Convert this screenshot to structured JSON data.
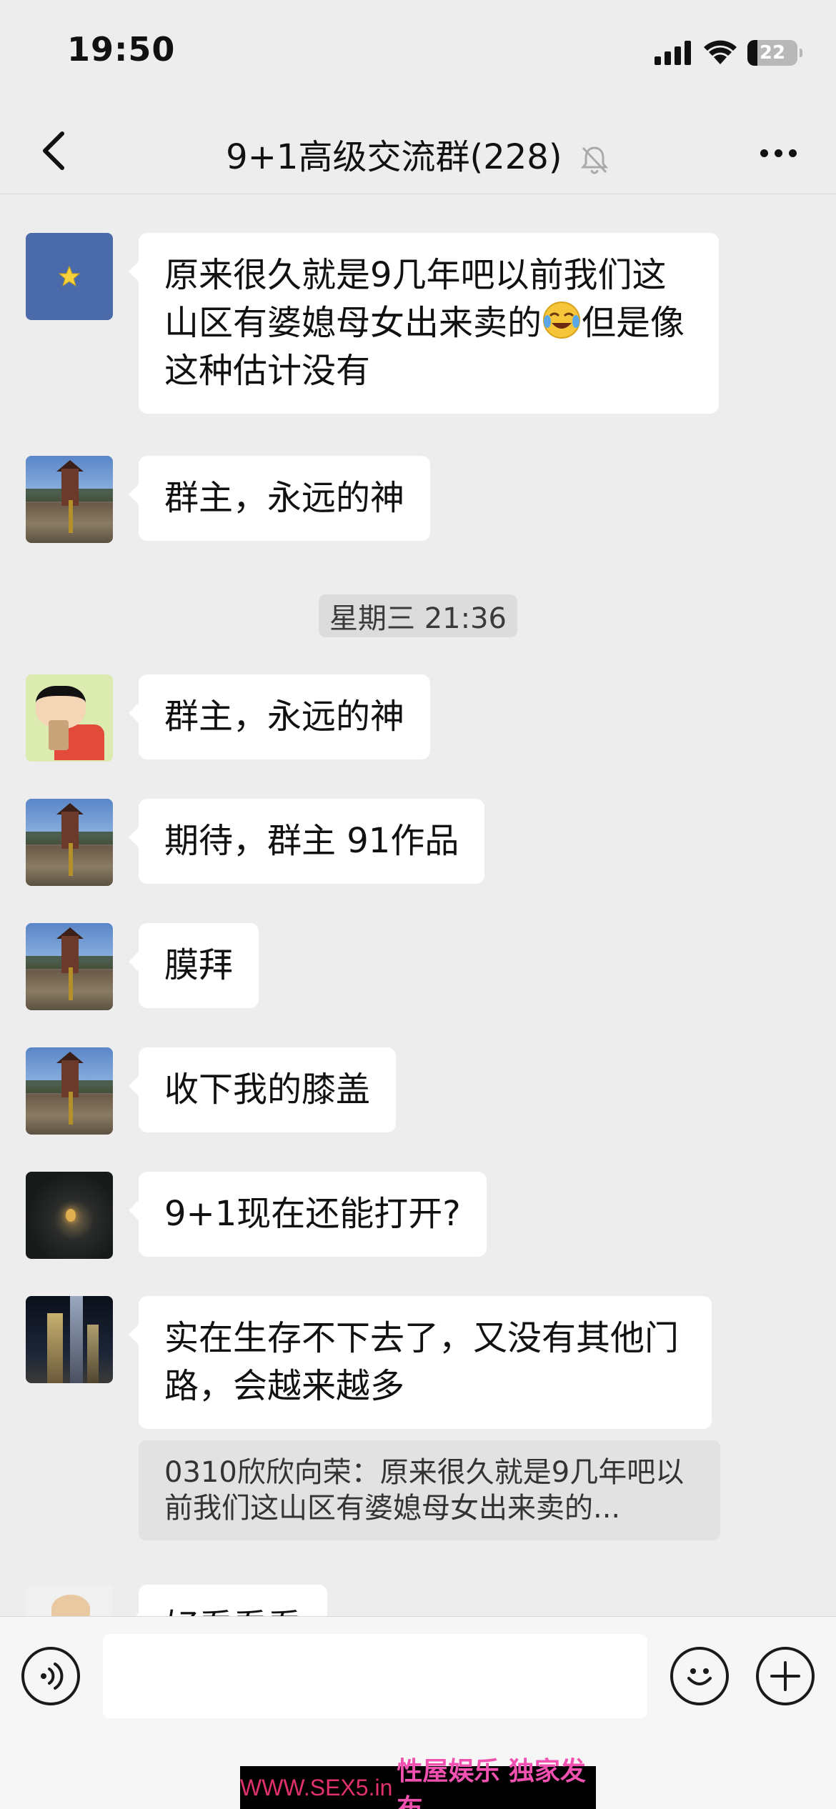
{
  "status_bar": {
    "time": "19:50",
    "battery": "22",
    "icons": [
      "signal-icon",
      "wifi-icon",
      "battery-icon"
    ]
  },
  "nav": {
    "title": "9+1高级交流群(228)",
    "icons": [
      "back-arrow-icon",
      "mute-bell-icon",
      "more-dots-icon"
    ]
  },
  "messages": [
    {
      "avatar": "star-flag",
      "text": "原来很久就是9几年吧以前我们这山区有婆媳母女出来卖的",
      "text_after_emoji": "但是像这种估计没有",
      "emoji": "tears-of-joy"
    },
    {
      "avatar": "town-square",
      "text": "群主，永远的神"
    },
    {
      "avatar": "cartoon-boy",
      "text": "群主，永远的神"
    },
    {
      "avatar": "town-square",
      "text": "期待，群主 91作品"
    },
    {
      "avatar": "town-square",
      "text": "膜拜"
    },
    {
      "avatar": "town-square",
      "text": "收下我的膝盖"
    },
    {
      "avatar": "dark-night",
      "text": "9+1现在还能打开?"
    },
    {
      "avatar": "city-towers",
      "text": "实在生存不下去了，又没有其他门路，会越来越多"
    },
    {
      "avatar": "hand",
      "text": "好看看看"
    }
  ],
  "timestamp": "星期三 21:36",
  "quote": "0310欣欣向荣：原来很久就是9几年吧以前我们这山区有婆媳母女出来卖的...",
  "input": {
    "placeholder": "",
    "icons": [
      "voice-icon",
      "emoji-icon",
      "plus-icon"
    ]
  },
  "watermark": {
    "url": "WWW.SEX5.in",
    "tag": "性屋娱乐 独家发布"
  },
  "colors": {
    "background": "#ededed",
    "bubble": "#ffffff",
    "quote_bg": "#e2e2e2",
    "watermark_url": "#e0306e",
    "watermark_tag": "#f050b0"
  }
}
